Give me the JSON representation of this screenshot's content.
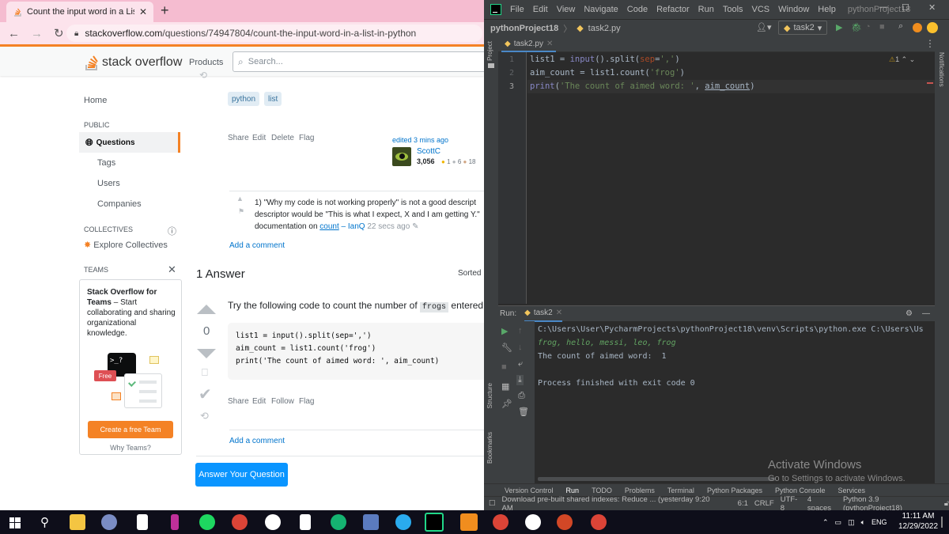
{
  "browser": {
    "tab_title": "Count the input word in a List in",
    "url_host": "stackoverflow.com",
    "url_path": "/questions/74947804/count-the-input-word-in-a-list-in-python"
  },
  "so": {
    "logo_text": "stack overflow",
    "products": "Products",
    "search_placeholder": "Search...",
    "nav": {
      "home": "Home",
      "public": "PUBLIC",
      "questions": "Questions",
      "tags": "Tags",
      "users": "Users",
      "companies": "Companies",
      "collectives": "COLLECTIVES",
      "explore_collectives": "Explore Collectives",
      "teams": "TEAMS"
    },
    "teams_box": {
      "title": "Stack Overflow for Teams",
      "body": "– Start collaborating and sharing organizational knowledge.",
      "free": "Free",
      "button": "Create a free Team",
      "why": "Why Teams?"
    },
    "tags": [
      "python",
      "list"
    ],
    "question_actions": [
      "Share",
      "Edit",
      "Delete",
      "Flag"
    ],
    "edited": "edited 3 mins ago",
    "editor_name": "ScottC",
    "editor_rep": "3,056",
    "editor_badges": [
      "1",
      "6",
      "18"
    ],
    "comment": {
      "number": "1)",
      "line1": "\"Why my code is not working properly\" is not a good descript",
      "line2": "descriptor would be \"This is what I expect, X and I am getting Y.\"",
      "line3_prefix": "documentation on",
      "line3_link": "count",
      "author": "– IanQ",
      "time": "22 secs ago"
    },
    "add_comment": "Add a comment",
    "answers_heading": "1 Answer",
    "sorted": "Sorted",
    "answer_intro": "Try the following code to count the number of",
    "answer_code_word": "frogs",
    "answer_intro_end": "entered",
    "vote_count": "0",
    "answer_code": [
      "list1 = input().split(sep=',')",
      "aim_count = list1.count('frog')",
      "print('The count of aimed word: ', aim_count)"
    ],
    "answer_actions": [
      "Share",
      "Edit",
      "Follow",
      "Flag"
    ],
    "add_comment2": "Add a comment",
    "answer_button": "Answer Your Question"
  },
  "pycharm": {
    "menu": [
      "File",
      "Edit",
      "View",
      "Navigate",
      "Code",
      "Refactor",
      "Run",
      "Tools",
      "VCS",
      "Window",
      "Help"
    ],
    "project_name": "pythonProject18",
    "breadcrumb_project": "pythonProject18",
    "breadcrumb_file": "task2.py",
    "run_config": "task2",
    "editor_tab": "task2.py",
    "inspection": "1",
    "line_numbers": [
      "1",
      "2",
      "3"
    ],
    "run_label": "Run:",
    "run_tab": "task2",
    "output": {
      "cmd": "C:\\Users\\User\\PycharmProjects\\pythonProject18\\venv\\Scripts\\python.exe C:\\Users\\Us",
      "input": "frog, hello, messi, leo, frog",
      "result": "The count of aimed word:  1",
      "exit": "Process finished with exit code 0"
    },
    "watermark_title": "Activate Windows",
    "watermark_sub": "Go to Settings to activate Windows.",
    "bottom_tabs": [
      "Version Control",
      "Run",
      "TODO",
      "Problems",
      "Terminal",
      "Python Packages",
      "Python Console",
      "Services"
    ],
    "status_message": "Download pre-built shared indexes: Reduce ... (yesterday 9:20 AM",
    "status_right": [
      "6:1",
      "CRLF",
      "UTF-8",
      "4 spaces",
      "Python 3.9 (pythonProject18)"
    ],
    "side_labels": [
      "Project",
      "Structure",
      "Bookmarks",
      "Notifications"
    ]
  },
  "taskbar": {
    "lang": "ENG",
    "time": "11:11 AM",
    "date": "12/29/2022"
  },
  "colors": {
    "so_orange": "#f48225",
    "so_blue": "#0a95ff",
    "pc_bg": "#2b2b2b",
    "tab_pink": "#f5bcd0"
  }
}
